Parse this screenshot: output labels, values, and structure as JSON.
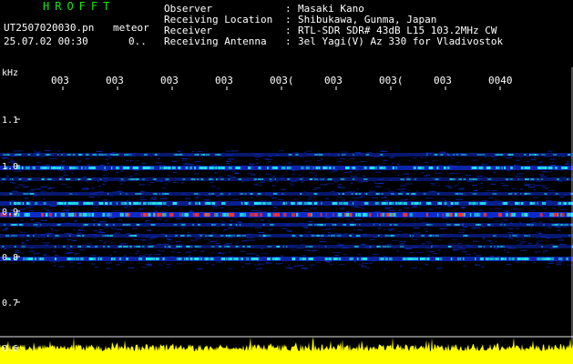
{
  "header": {
    "brand": "HROFFT",
    "filename": "UT2507020030.pn",
    "tag": "meteor",
    "datetime": "25.07.02 00:30",
    "extra": "0..",
    "info": [
      {
        "label": "Observer",
        "value": "Masaki Kano"
      },
      {
        "label": "Receiving Location",
        "value": "Shibukawa, Gunma, Japan"
      },
      {
        "label": "Receiver",
        "value": "RTL-SDR SDR# 43dB L15 103.2MHz CW"
      },
      {
        "label": "Receiving Antenna",
        "value": "3el Yagi(V) Az 330 for Vladivostok"
      }
    ]
  },
  "spectrogram": {
    "y_unit": "kHz",
    "y_ticks": [
      "1.1",
      "1.0",
      "0.9",
      "0.8",
      "0.7",
      "0.6"
    ],
    "time_labels": [
      "003",
      "003",
      "003",
      "003",
      "003(",
      "003",
      "003(",
      "003",
      "0040"
    ],
    "colors": {
      "background": "#000000",
      "noise": "#0d2bc8",
      "signal_mid": "#1fe6e6",
      "signal_high": "#ff3030",
      "level_trace": "#ffff00",
      "header_brand": "#19e619",
      "text": "#ffffff"
    }
  }
}
